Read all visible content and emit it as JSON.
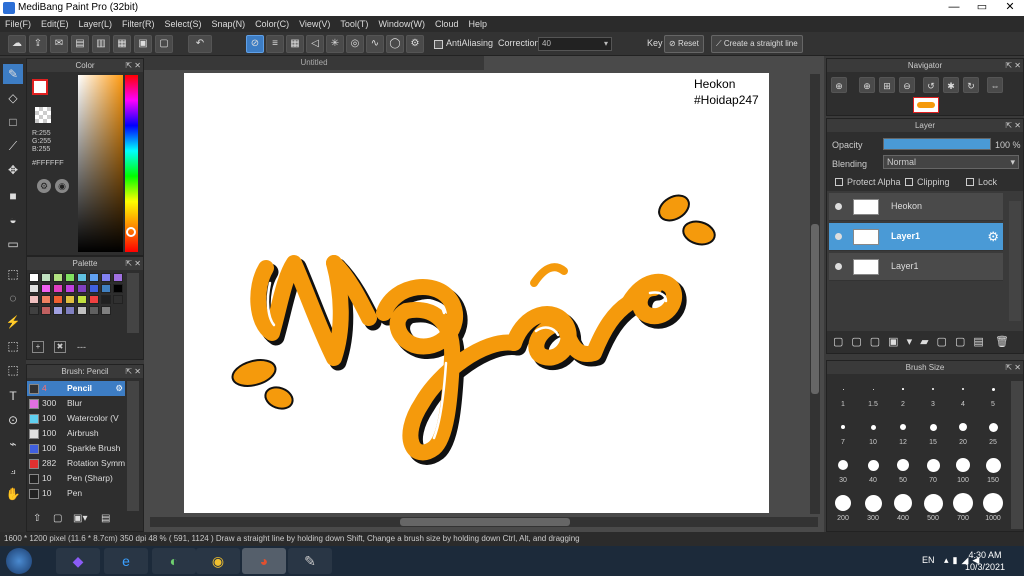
{
  "window": {
    "title": "MediBang Paint Pro (32bit)"
  },
  "menu": [
    "File(F)",
    "Edit(E)",
    "Layer(L)",
    "Filter(R)",
    "Select(S)",
    "Snap(N)",
    "Color(C)",
    "View(V)",
    "Tool(T)",
    "Window(W)",
    "Cloud",
    "Help"
  ],
  "toolbar": {
    "antialias_label": "AntiAliasing",
    "correction_label": "Correction",
    "correction_value": "40",
    "key_label": "Key",
    "reset_label": "Reset",
    "straight_label": "Create a straight line"
  },
  "color_panel": {
    "title": "Color",
    "r": "R:255",
    "g": "G:255",
    "b": "B:255",
    "hex": "#FFFFFF"
  },
  "palette_panel": {
    "title": "Palette",
    "footer": "---",
    "colors": [
      "#ffffff",
      "#c0e0c0",
      "#b0e080",
      "#80e060",
      "#60c0e0",
      "#60a0f0",
      "#8080f0",
      "#a070e0",
      "#e0e0e0",
      "#f060f0",
      "#e040c0",
      "#c040e0",
      "#8040c0",
      "#4060e0",
      "#4080c0",
      "#000000",
      "#f0c0c0",
      "#f08060",
      "#f06030",
      "#e0c040",
      "#c0e040",
      "#f04040",
      "#202020",
      "#303030",
      "#404040",
      "#c06060",
      "#a0a0e0",
      "#8080c0",
      "#c0c0c0",
      "#606060",
      "#808080"
    ]
  },
  "brush_panel": {
    "title": "Brush: Pencil",
    "items": [
      {
        "num": "4",
        "name": "Pencil",
        "color": "#333"
      },
      {
        "num": "300",
        "name": "Blur",
        "color": "#e070e0"
      },
      {
        "num": "100",
        "name": "Watercolor (V",
        "color": "#60d0f0"
      },
      {
        "num": "100",
        "name": "Airbrush",
        "color": "#e0e0e0"
      },
      {
        "num": "100",
        "name": "Sparkle Brush",
        "color": "#4060e0"
      },
      {
        "num": "282",
        "name": "Rotation Symm",
        "color": "#e03030"
      },
      {
        "num": "10",
        "name": "Pen (Sharp)",
        "color": "#222"
      },
      {
        "num": "10",
        "name": "Pen",
        "color": "#222"
      }
    ]
  },
  "document": {
    "tab": "Untitled",
    "sig_line1": "Heokon",
    "sig_line2": "#Hoidap247"
  },
  "navigator": {
    "title": "Navigator"
  },
  "layer_panel": {
    "title": "Layer",
    "opacity_label": "Opacity",
    "opacity_value": "100 %",
    "blending_label": "Blending",
    "blending_value": "Normal",
    "protect_alpha": "Protect Alpha",
    "clipping": "Clipping",
    "lock": "Lock",
    "layers": [
      {
        "name": "Heokon"
      },
      {
        "name": "Layer1"
      },
      {
        "name": "Layer1"
      }
    ]
  },
  "brush_size_panel": {
    "title": "Brush Size",
    "sizes": [
      "1",
      "1.5",
      "2",
      "3",
      "4",
      "5",
      "7",
      "10",
      "12",
      "15",
      "20",
      "25",
      "30",
      "40",
      "50",
      "70",
      "100",
      "150",
      "200",
      "300",
      "400",
      "500",
      "700",
      "1000"
    ]
  },
  "status": {
    "text": "1600 * 1200 pixel  (11.6 * 8.7cm)  350 dpi  48 %  ( 591, 1124 )  Draw a straight line by holding down Shift, Change a brush size by holding down Ctrl, Alt, and dragging"
  },
  "taskbar": {
    "lang": "EN",
    "time": "4:30 AM",
    "date": "10/3/2021"
  }
}
